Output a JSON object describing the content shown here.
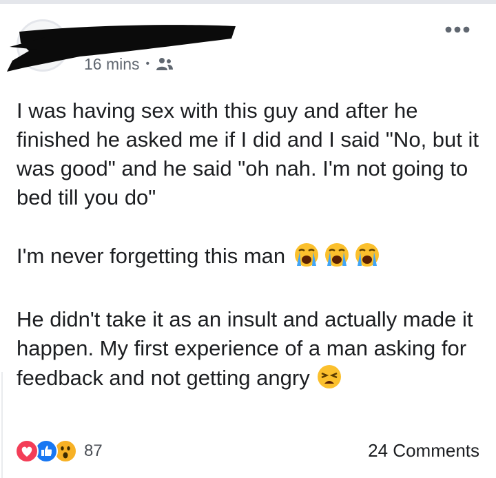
{
  "post": {
    "timestamp": "16 mins",
    "separator": "•",
    "audience_icon": "friends-icon",
    "more_icon": "more-options-icon",
    "paragraphs": [
      "I was having sex with this guy and after he finished he asked me if I did and I said \"No, but it was good\" and he said \"oh nah. I'm not going to bed till you do\"",
      "I'm never forgetting this man",
      "He didn't take it as an insult and actually made it happen. My first experience of a man asking for feedback and not getting angry"
    ],
    "paragraph_emojis": {
      "p2": [
        "loudly-crying-face-emoji",
        "loudly-crying-face-emoji",
        "loudly-crying-face-emoji"
      ],
      "p3": [
        "weary-face-emoji"
      ]
    }
  },
  "footer": {
    "reaction_icons": [
      "love-reaction-icon",
      "like-reaction-icon",
      "wow-reaction-icon"
    ],
    "reaction_count": "87",
    "comments": "24 Comments"
  },
  "colors": {
    "love": "#f33e58",
    "like": "#1877f2",
    "wow": "#f7b125",
    "meta_text": "#606770"
  }
}
